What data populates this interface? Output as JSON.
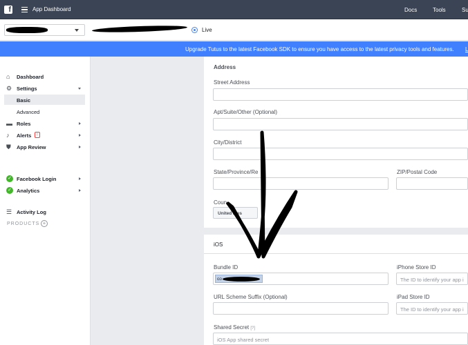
{
  "topbar": {
    "logo": "f",
    "app_title": "App Dashboard",
    "links": [
      "Docs",
      "Tools",
      "Su"
    ]
  },
  "appbar": {
    "live_label": "Live"
  },
  "banner": {
    "text": "Upgrade Tutus to the latest Facebook SDK to ensure you have access to the latest privacy tools and features.",
    "link": "L"
  },
  "sidebar": {
    "dashboard": "Dashboard",
    "settings": "Settings",
    "basic": "Basic",
    "advanced": "Advanced",
    "roles": "Roles",
    "alerts": "Alerts",
    "alerts_badge": "!",
    "app_review": "App Review",
    "products_heading": "PRODUCTS",
    "facebook_login": "Facebook Login",
    "analytics": "Analytics",
    "activity_log": "Activity Log"
  },
  "address": {
    "heading": "Address",
    "street_label": "Street Address",
    "apt_label": "Apt/Suite/Other (Optional)",
    "city_label": "City/District",
    "state_label": "State/Province/Re",
    "zip_label": "ZIP/Postal Code",
    "country_label": "Coun",
    "country_value": "United   ates"
  },
  "ios": {
    "heading": "iOS",
    "bundle_label": "Bundle ID",
    "bundle_value": "co",
    "iphone_label": "iPhone Store ID",
    "iphone_placeholder": "The ID to identify your app i",
    "url_scheme_label": "URL Scheme Suffix (Optional)",
    "ipad_label": "iPad Store ID",
    "ipad_placeholder": "The ID to identify your app i",
    "shared_secret_label": "Shared Secret",
    "shared_secret_hint": "[?]",
    "shared_secret_placeholder": "iOS App shared secret"
  },
  "colors": {
    "topbar": "#3b4454",
    "banner": "#4080ff",
    "success": "#42b72a"
  }
}
